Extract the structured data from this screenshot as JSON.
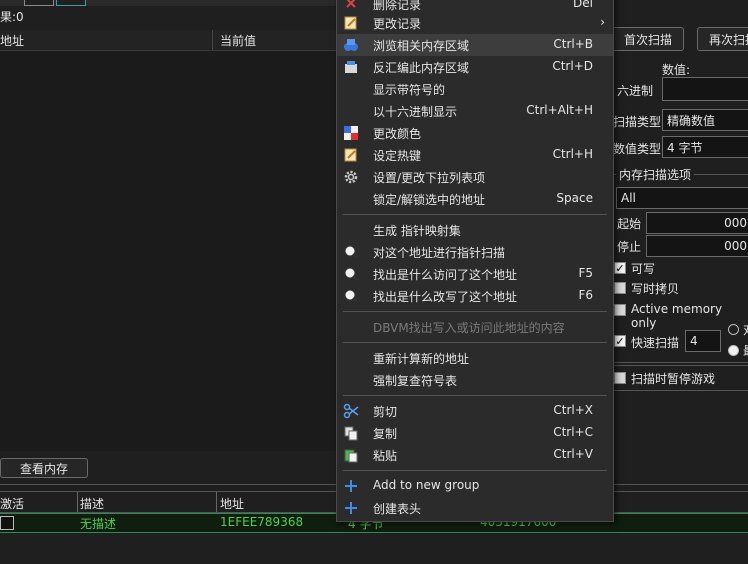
{
  "results_label": "果:0",
  "list_header": {
    "address": "地址",
    "current_value": "当前值"
  },
  "buttons": {
    "first_scan": "首次扫描",
    "next_scan": "再次扫描",
    "view_memory": "查看内存"
  },
  "right_panel": {
    "value_label": "数值:",
    "hex_label": "六进制",
    "scan_type_label": "扫描类型",
    "scan_type_value": "精确数值",
    "value_type_label": "数值类型",
    "value_type_value": "4 字节",
    "mem_scan_options": "内存扫描选项",
    "mem_region": "All",
    "start_label": "起始",
    "start_value": "000",
    "stop_label": "停止",
    "stop_value": "000",
    "writable": "可写",
    "copy_on_write": "写时拷贝",
    "active_memory": "Active memory only",
    "fast_scan": "快速扫描",
    "fast_scan_value": "4",
    "radio1_text": "对",
    "radio2_text": "最",
    "pause_game": "扫描时暂停游戏"
  },
  "bottom_table": {
    "headers": [
      "激活",
      "描述",
      "地址"
    ],
    "row": {
      "description": "无描述",
      "address": "1EFEE789368",
      "type": "4 字节",
      "value": "4031917600"
    }
  },
  "context_menu": {
    "items": [
      {
        "label": "删除记录",
        "shortcut": "Del",
        "icon": "delete-icon"
      },
      {
        "label": "更改记录",
        "shortcut": "›",
        "icon": "edit-record-icon"
      },
      {
        "label": "浏览相关内存区域",
        "shortcut": "Ctrl+B",
        "icon": "browse-memory-icon"
      },
      {
        "label": "反汇编此内存区域",
        "shortcut": "Ctrl+D",
        "icon": "disassemble-icon"
      },
      {
        "label": "显示带符号的",
        "shortcut": "",
        "icon": ""
      },
      {
        "label": "以十六进制显示",
        "shortcut": "Ctrl+Alt+H",
        "icon": ""
      },
      {
        "label": "更改颜色",
        "shortcut": "",
        "icon": "color-icon"
      },
      {
        "label": "设定热键",
        "shortcut": "Ctrl+H",
        "icon": "hotkey-icon"
      },
      {
        "label": "设置/更改下拉列表项",
        "shortcut": "",
        "icon": "gear-icon"
      },
      {
        "label": "锁定/解锁选中的地址",
        "shortcut": "Space",
        "icon": ""
      },
      {
        "label": "生成 指针映射集",
        "shortcut": "",
        "icon": ""
      },
      {
        "label": "对这个地址进行指针扫描",
        "shortcut": "",
        "icon": "pointer-scan-icon"
      },
      {
        "label": "找出是什么访问了这个地址",
        "shortcut": "F5",
        "icon": "find-access-icon"
      },
      {
        "label": "找出是什么改写了这个地址",
        "shortcut": "F6",
        "icon": "find-write-icon"
      },
      {
        "label": "DBVM找出写入或访问此地址的内容",
        "shortcut": "",
        "icon": ""
      },
      {
        "label": "重新计算新的地址",
        "shortcut": "",
        "icon": ""
      },
      {
        "label": "强制复查符号表",
        "shortcut": "",
        "icon": ""
      },
      {
        "label": "剪切",
        "shortcut": "Ctrl+X",
        "icon": "cut-icon"
      },
      {
        "label": "复制",
        "shortcut": "Ctrl+C",
        "icon": "copy-icon"
      },
      {
        "label": "粘贴",
        "shortcut": "Ctrl+V",
        "icon": "paste-icon"
      },
      {
        "label": "Add to new group",
        "shortcut": "",
        "icon": "plus-icon"
      },
      {
        "label": "创建表头",
        "shortcut": "",
        "icon": "plus-icon"
      }
    ]
  }
}
